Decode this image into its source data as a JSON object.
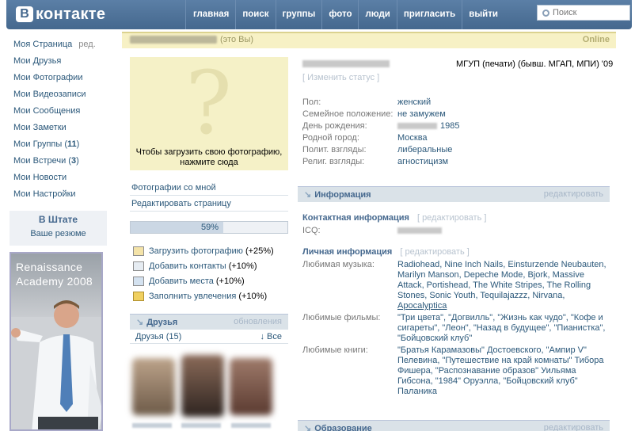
{
  "header": {
    "logo_letter": "B",
    "logo_text": "контакте",
    "nav": [
      "главная",
      "поиск",
      "группы",
      "фото",
      "люди",
      "пригласить",
      "выйти"
    ],
    "search_placeholder": "Поиск"
  },
  "sidebar": {
    "items": [
      {
        "label": "Моя Страница",
        "extra": "ред."
      },
      {
        "label": "Мои Друзья"
      },
      {
        "label": "Мои Фотографии"
      },
      {
        "label": "Мои Видеозаписи"
      },
      {
        "label": "Мои Сообщения"
      },
      {
        "label": "Мои Заметки"
      },
      {
        "label": "Мои Группы",
        "count": "11"
      },
      {
        "label": "Мои Встречи",
        "count": "3"
      },
      {
        "label": "Мои Новости"
      },
      {
        "label": "Мои Настройки"
      }
    ],
    "promo_title": "В Штате",
    "promo_link": "Ваше резюме",
    "ad_text_1": "Renaissance",
    "ad_text_2": "Academy 2008"
  },
  "topbar": {
    "you": "(это Вы)",
    "online": "Online"
  },
  "photo": {
    "line1": "Чтобы загрузить свою фотографию,",
    "line2": "нажмите сюда"
  },
  "left_links": [
    "Фотографии со мной",
    "Редактировать страницу"
  ],
  "progress": {
    "percent": 59,
    "label": "59%"
  },
  "tips": [
    {
      "label": "Загрузить фотографию",
      "value": "(+25%)",
      "icon": "photo-icon"
    },
    {
      "label": "Добавить контакты",
      "value": "(+10%)",
      "icon": "contacts-icon"
    },
    {
      "label": "Добавить места",
      "value": "(+10%)",
      "icon": "house-icon"
    },
    {
      "label": "Заполнить увлечения",
      "value": "(+10%)",
      "icon": "pencil-icon"
    }
  ],
  "friends": {
    "title": "Друзья",
    "updates": "обновления",
    "count_label": "Друзья (15)",
    "all_label": "↓ Все"
  },
  "profile": {
    "university": "МГУП (печати) (бывш. МГАП, МПИ) '09",
    "status_link": "[ Изменить статус ]",
    "rows": [
      {
        "k": "Пол:",
        "v": "женский"
      },
      {
        "k": "Семейное положение:",
        "v": "не замужем"
      },
      {
        "k": "День рождения:",
        "v": "1985"
      },
      {
        "k": "Родной город:",
        "v": "Москва"
      },
      {
        "k": "Полит. взгляды:",
        "v": "либеральные"
      },
      {
        "k": "Религ. взгляды:",
        "v": "агностицизм"
      }
    ]
  },
  "info": {
    "title": "Информация",
    "edit": "редактировать",
    "contact_title": "Контактная информация",
    "contact_edit": "[ редактировать ]",
    "icq_label": "ICQ:",
    "personal_title": "Личная информация",
    "personal_edit": "[ редактировать ]",
    "music_label": "Любимая музыка:",
    "music_value": "Radiohead, Nine Inch Nails, Einsturzende Neubauten, Marilyn Manson, Depeche Mode, Bjork, Massive Attack, Portishead, The White Stripes, The Rolling Stones, Sonic Youth, Tequilajazzz, Nirvana,",
    "music_last": "Apocalyptica",
    "films_label": "Любимые фильмы:",
    "films_value": "\"Три цвета\", \"Догвилль\", \"Жизнь как чудо\", \"Кофе и сигареты\", \"Леон\", \"Назад в будущее\", \"Пианистка\", \"Бойцовский клуб\"",
    "books_label": "Любимые книги:",
    "books_value": "\"Братья Карамазовы\" Достоевского, \"Ампир V\" Пелевина, \"Путешествие на край комнаты\" Тибора Фишера, \"Распознавание образов\" Уильяма Гибсона, \"1984\" Оруэлла, \"Бойцовский клуб\" Паланика"
  },
  "education": {
    "title": "Образование",
    "edit": "редактировать"
  }
}
